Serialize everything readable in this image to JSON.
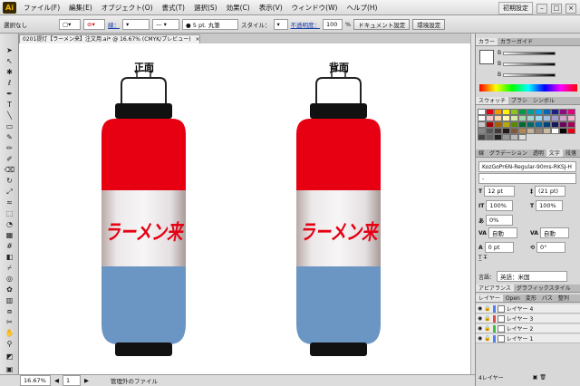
{
  "app": {
    "logo": "Ai",
    "brand_color": "#f5b400"
  },
  "menubar": {
    "items": [
      "ファイル(F)",
      "編集(E)",
      "オブジェクト(O)",
      "書式(T)",
      "選択(S)",
      "効果(C)",
      "表示(V)",
      "ウィンドウ(W)",
      "ヘルプ(H)"
    ],
    "workspace": "初期設定"
  },
  "controlbar": {
    "selection": "選択なし",
    "stroke_label": "線：",
    "brush": "● 5 pt. 丸筆",
    "style_label": "スタイル：",
    "opacity_label": "不透明度：",
    "opacity_value": "100",
    "opacity_unit": "%",
    "doc_setup": "ドキュメント設定",
    "prefs": "環境設定"
  },
  "document": {
    "tab_title": "0201提灯【ラーメン来】注文用.ai* @ 16.67% (CMYK/プレビュー)",
    "close": "×"
  },
  "artwork": {
    "front_label": "正面",
    "back_label": "背面",
    "lantern_text": "ラーメン来",
    "colors": {
      "red": "#e60012",
      "blue": "#6b96c3",
      "white": "#f0eef0",
      "text_red": "#e60012"
    }
  },
  "statusbar": {
    "zoom": "16.67%",
    "page": "1",
    "status_text": "管理外のファイル"
  },
  "panels": {
    "color": {
      "tabs": [
        "カラー",
        "カラーガイド"
      ],
      "channels": [
        "B",
        "B",
        "B"
      ]
    },
    "swatches": {
      "tabs": [
        "スウォッチ",
        "ブラシ",
        "シンボル"
      ],
      "colors": [
        "#ffffff",
        "#e60012",
        "#f39800",
        "#fff100",
        "#8fc31f",
        "#009944",
        "#009e96",
        "#00a0e9",
        "#0068b7",
        "#1d2088",
        "#920783",
        "#e4007f",
        "#ffffff",
        "#f8c3c8",
        "#fbd6a8",
        "#fff8b5",
        "#d7e7a9",
        "#a5d4ad",
        "#a3d6cc",
        "#a0d8ef",
        "#a3bce2",
        "#a59aca",
        "#cfa7cd",
        "#f4b4d0",
        "#c9c9c9",
        "#a40000",
        "#a85f00",
        "#b5ab00",
        "#5a8a00",
        "#006a30",
        "#006b66",
        "#006ea4",
        "#00447f",
        "#14175e",
        "#68055d",
        "#a4005b",
        "#888888",
        "#595757",
        "#3e3a39",
        "#231815",
        "#7d5a3c",
        "#b28850",
        "#c7b299",
        "#998675",
        "#c9bc9c",
        "#ffffff",
        "#000000",
        "#e60012",
        "#444444",
        "#666666",
        "#222222",
        "#999999",
        "#bbbbbb",
        "#dddddd"
      ]
    },
    "character": {
      "tabs": [
        "線",
        "グラデーション",
        "透明",
        "文字",
        "段落"
      ],
      "font": "KozGoPr6N-Regular-90ms-RKSJ-H",
      "size": "12 pt",
      "leading": "(21 pt)",
      "scale_v": "100%",
      "scale_h": "100%",
      "kerning": "0%",
      "tracking_a": "自動",
      "tracking_b": "自動",
      "baseline": "0 pt",
      "rotation": "0°",
      "language_label": "言語：",
      "language": "英語：米国"
    },
    "appearance": {
      "tabs": [
        "アピアランス",
        "グラフィックスタイル"
      ]
    },
    "layers": {
      "tabs": [
        "レイヤー",
        "Open",
        "変形",
        "パス",
        "整列"
      ],
      "items": [
        "レイヤー 4",
        "レイヤー 3",
        "レイヤー 2",
        "レイヤー 1"
      ],
      "footer": "4レイヤー"
    }
  }
}
